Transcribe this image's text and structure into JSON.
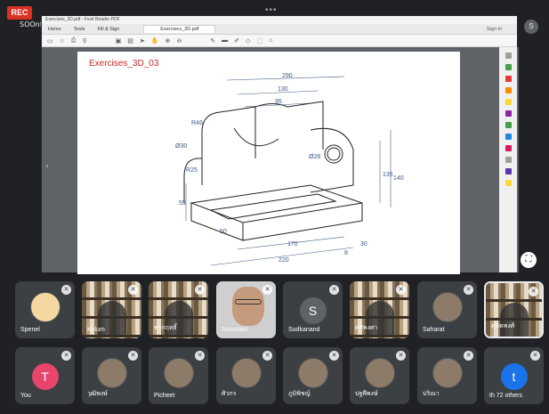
{
  "recording": {
    "label": "REC"
  },
  "presenter": {
    "label": "SOOnf"
  },
  "top_menu": {
    "dots": "•••"
  },
  "self_avatar": {
    "letter": "S"
  },
  "pdf": {
    "window_title": "Exercises_3D.pdf - Foxit Reader PDF",
    "menu": [
      "Home",
      "Tools",
      "Fill & Sign"
    ],
    "active_tab": "Exercises_3D.pdf",
    "right_menu": [
      "Sign In"
    ],
    "toolbar_icons": [
      "document-icon",
      "star-icon",
      "print-icon",
      "zoom-icon",
      "save-icon",
      "page-icon",
      "cursor-icon",
      "hand-icon",
      "zoom-in-icon",
      "zoom-out-icon",
      "comment-icon",
      "highlight-icon",
      "pen-icon",
      "shape-icon",
      "stamp-icon",
      "attach-icon"
    ]
  },
  "drawing": {
    "title": "Exercises_3D_03",
    "dims": [
      "290",
      "130",
      "95",
      "R46",
      "Ø30",
      "R25",
      "55",
      "Ø28",
      "135",
      "140",
      "50",
      "170",
      "220",
      "8",
      "30"
    ]
  },
  "participants": [
    {
      "name": "Spenel",
      "kind": "cartoon"
    },
    {
      "name": "Kolum",
      "kind": "shelf"
    },
    {
      "name": "พรกฤทธิ์",
      "kind": "shelf"
    },
    {
      "name": "Soomtam",
      "kind": "face"
    },
    {
      "name": "Sudkanand",
      "kind": "letter",
      "letter": "S",
      "color": "#5f6368"
    },
    {
      "name": "ศศิพงศา",
      "kind": "shelf"
    },
    {
      "name": "Saharat",
      "kind": "photo"
    },
    {
      "name": "ดุษิตพงศ์",
      "kind": "shelf"
    },
    {
      "name": "You",
      "kind": "letter",
      "letter": "T",
      "color": "#e8456b"
    },
    {
      "name": "วุฒิพงษ์",
      "kind": "photo"
    },
    {
      "name": "Picheet",
      "kind": "photo"
    },
    {
      "name": "ศิวกร",
      "kind": "photo"
    },
    {
      "name": "ภูมิพิชญ์",
      "kind": "photo"
    },
    {
      "name": "ปฐพีพงษ์",
      "kind": "photo"
    },
    {
      "name": "ปริณา",
      "kind": "photo"
    },
    {
      "name": "th 72 others",
      "kind": "letter",
      "letter": "t",
      "color": "#1a73e8"
    }
  ],
  "fullscreen": {
    "icon": "⛶"
  }
}
